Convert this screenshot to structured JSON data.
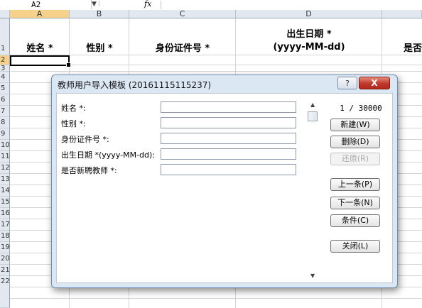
{
  "formula_bar": {
    "name_box": "A2",
    "fx": "fx"
  },
  "columns": [
    "A",
    "B",
    "C",
    "D"
  ],
  "rows": [
    "1",
    "2",
    "3",
    "4",
    "5",
    "6",
    "7",
    "8",
    "9",
    "10",
    "11",
    "12",
    "13",
    "14",
    "15",
    "16",
    "17",
    "18",
    "19",
    "20",
    "21",
    "22"
  ],
  "header_row": {
    "a": "姓名 *",
    "b": "性别 *",
    "c": "身份证件号 *",
    "d_line1": "出生日期 *",
    "d_line2": "(yyyy-MM-dd)",
    "e": "是否"
  },
  "dialog": {
    "title": "教师用户导入模板 (20161115115237)",
    "help": "?",
    "close": "X",
    "fields": [
      {
        "label": "姓名 *:"
      },
      {
        "label": "性别 *:"
      },
      {
        "label": "身份证件号 *:"
      },
      {
        "label": "出生日期 *(yyyy-MM-dd):"
      },
      {
        "label": "是否新聘教师 *:"
      }
    ],
    "counter": "1 / 30000",
    "buttons": {
      "new": "新建(W)",
      "delete": "删除(D)",
      "restore": "还原(R)",
      "prev": "上一条(P)",
      "next": "下一条(N)",
      "criteria": "条件(C)",
      "close": "关闭(L)"
    }
  }
}
